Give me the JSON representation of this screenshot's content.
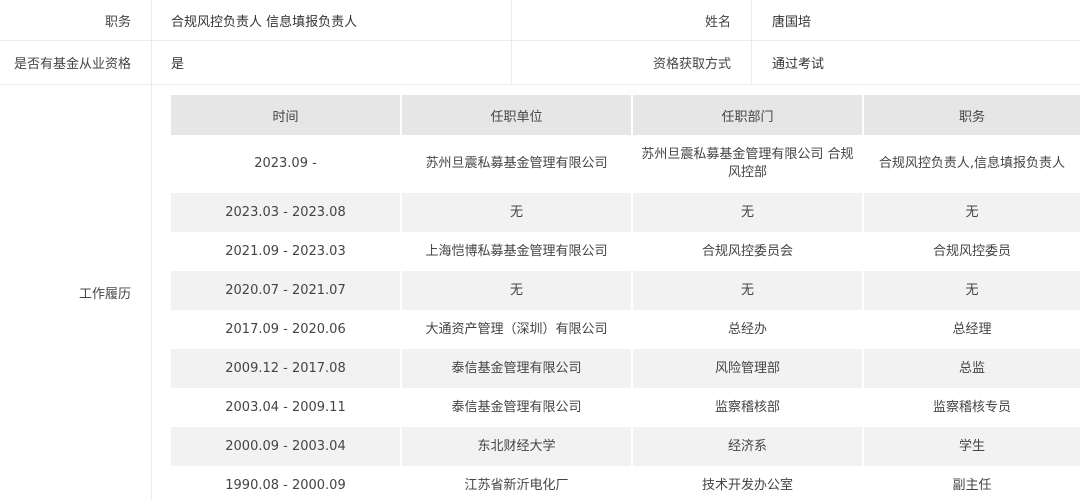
{
  "info": {
    "position_label": "职务",
    "position_value": "合规风控负责人 信息填报负责人",
    "name_label": "姓名",
    "name_value": "唐国培",
    "qualification_label": "是否有基金从业资格",
    "qualification_value": "是",
    "method_label": "资格获取方式",
    "method_value": "通过考试"
  },
  "history": {
    "label": "工作履历",
    "headers": [
      "时间",
      "任职单位",
      "任职部门",
      "职务"
    ],
    "rows": [
      {
        "time": "2023.09 -",
        "org": "苏州旦震私募基金管理有限公司",
        "dept": "苏州旦震私募基金管理有限公司 合规风控部",
        "title": "合规风控负责人,信息填报负责人"
      },
      {
        "time": "2023.03 - 2023.08",
        "org": "无",
        "dept": "无",
        "title": "无"
      },
      {
        "time": "2021.09 - 2023.03",
        "org": "上海恺博私募基金管理有限公司",
        "dept": "合规风控委员会",
        "title": "合规风控委员"
      },
      {
        "time": "2020.07 - 2021.07",
        "org": "无",
        "dept": "无",
        "title": "无"
      },
      {
        "time": "2017.09 - 2020.06",
        "org": "大通资产管理（深圳）有限公司",
        "dept": "总经办",
        "title": "总经理"
      },
      {
        "time": "2009.12 - 2017.08",
        "org": "泰信基金管理有限公司",
        "dept": "风险管理部",
        "title": "总监"
      },
      {
        "time": "2003.04 - 2009.11",
        "org": "泰信基金管理有限公司",
        "dept": "监察稽核部",
        "title": "监察稽核专员"
      },
      {
        "time": "2000.09 - 2003.04",
        "org": "东北财经大学",
        "dept": "经济系",
        "title": "学生"
      },
      {
        "time": "1990.08 - 2000.09",
        "org": "江苏省新沂电化厂",
        "dept": "技术开发办公室",
        "title": "副主任"
      }
    ]
  }
}
